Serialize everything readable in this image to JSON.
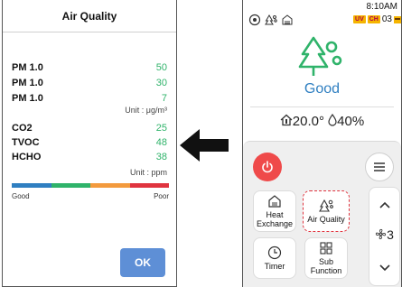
{
  "left_panel": {
    "title": "Air Quality",
    "pm_rows": [
      {
        "label": "PM 1.0",
        "value": "50"
      },
      {
        "label": "PM 1.0",
        "value": "30"
      },
      {
        "label": "PM 1.0",
        "value": "7"
      }
    ],
    "pm_unit": "Unit : μg/m³",
    "gas_rows": [
      {
        "label": "CO2",
        "value": "25"
      },
      {
        "label": "TVOC",
        "value": "48"
      },
      {
        "label": "HCHO",
        "value": "38"
      }
    ],
    "gas_unit": "Unit : ppm",
    "scale": {
      "colors": [
        "#2f7fc1",
        "#2fb36a",
        "#f39a3d",
        "#e0343f"
      ],
      "good_label": "Good",
      "poor_label": "Poor"
    },
    "ok_label": "OK",
    "value_color": "#2fb36a"
  },
  "right_panel": {
    "time": "8:10AM",
    "status_icons": [
      "target-icon",
      "air-quality-small-icon",
      "heat-exchange-small-icon"
    ],
    "badges": [
      "UV",
      "CH"
    ],
    "badge_count": "03",
    "air_status": "Good",
    "temperature": "20.0",
    "humidity": "40%",
    "buttons": {
      "heat_exchange": "Heat Exchange",
      "air_quality": "Air Quality",
      "timer": "Timer",
      "sub_function": "Sub Function"
    },
    "fan_level": "3",
    "accent_color": "#2f7fc1",
    "power_color": "#ef4a4a"
  }
}
